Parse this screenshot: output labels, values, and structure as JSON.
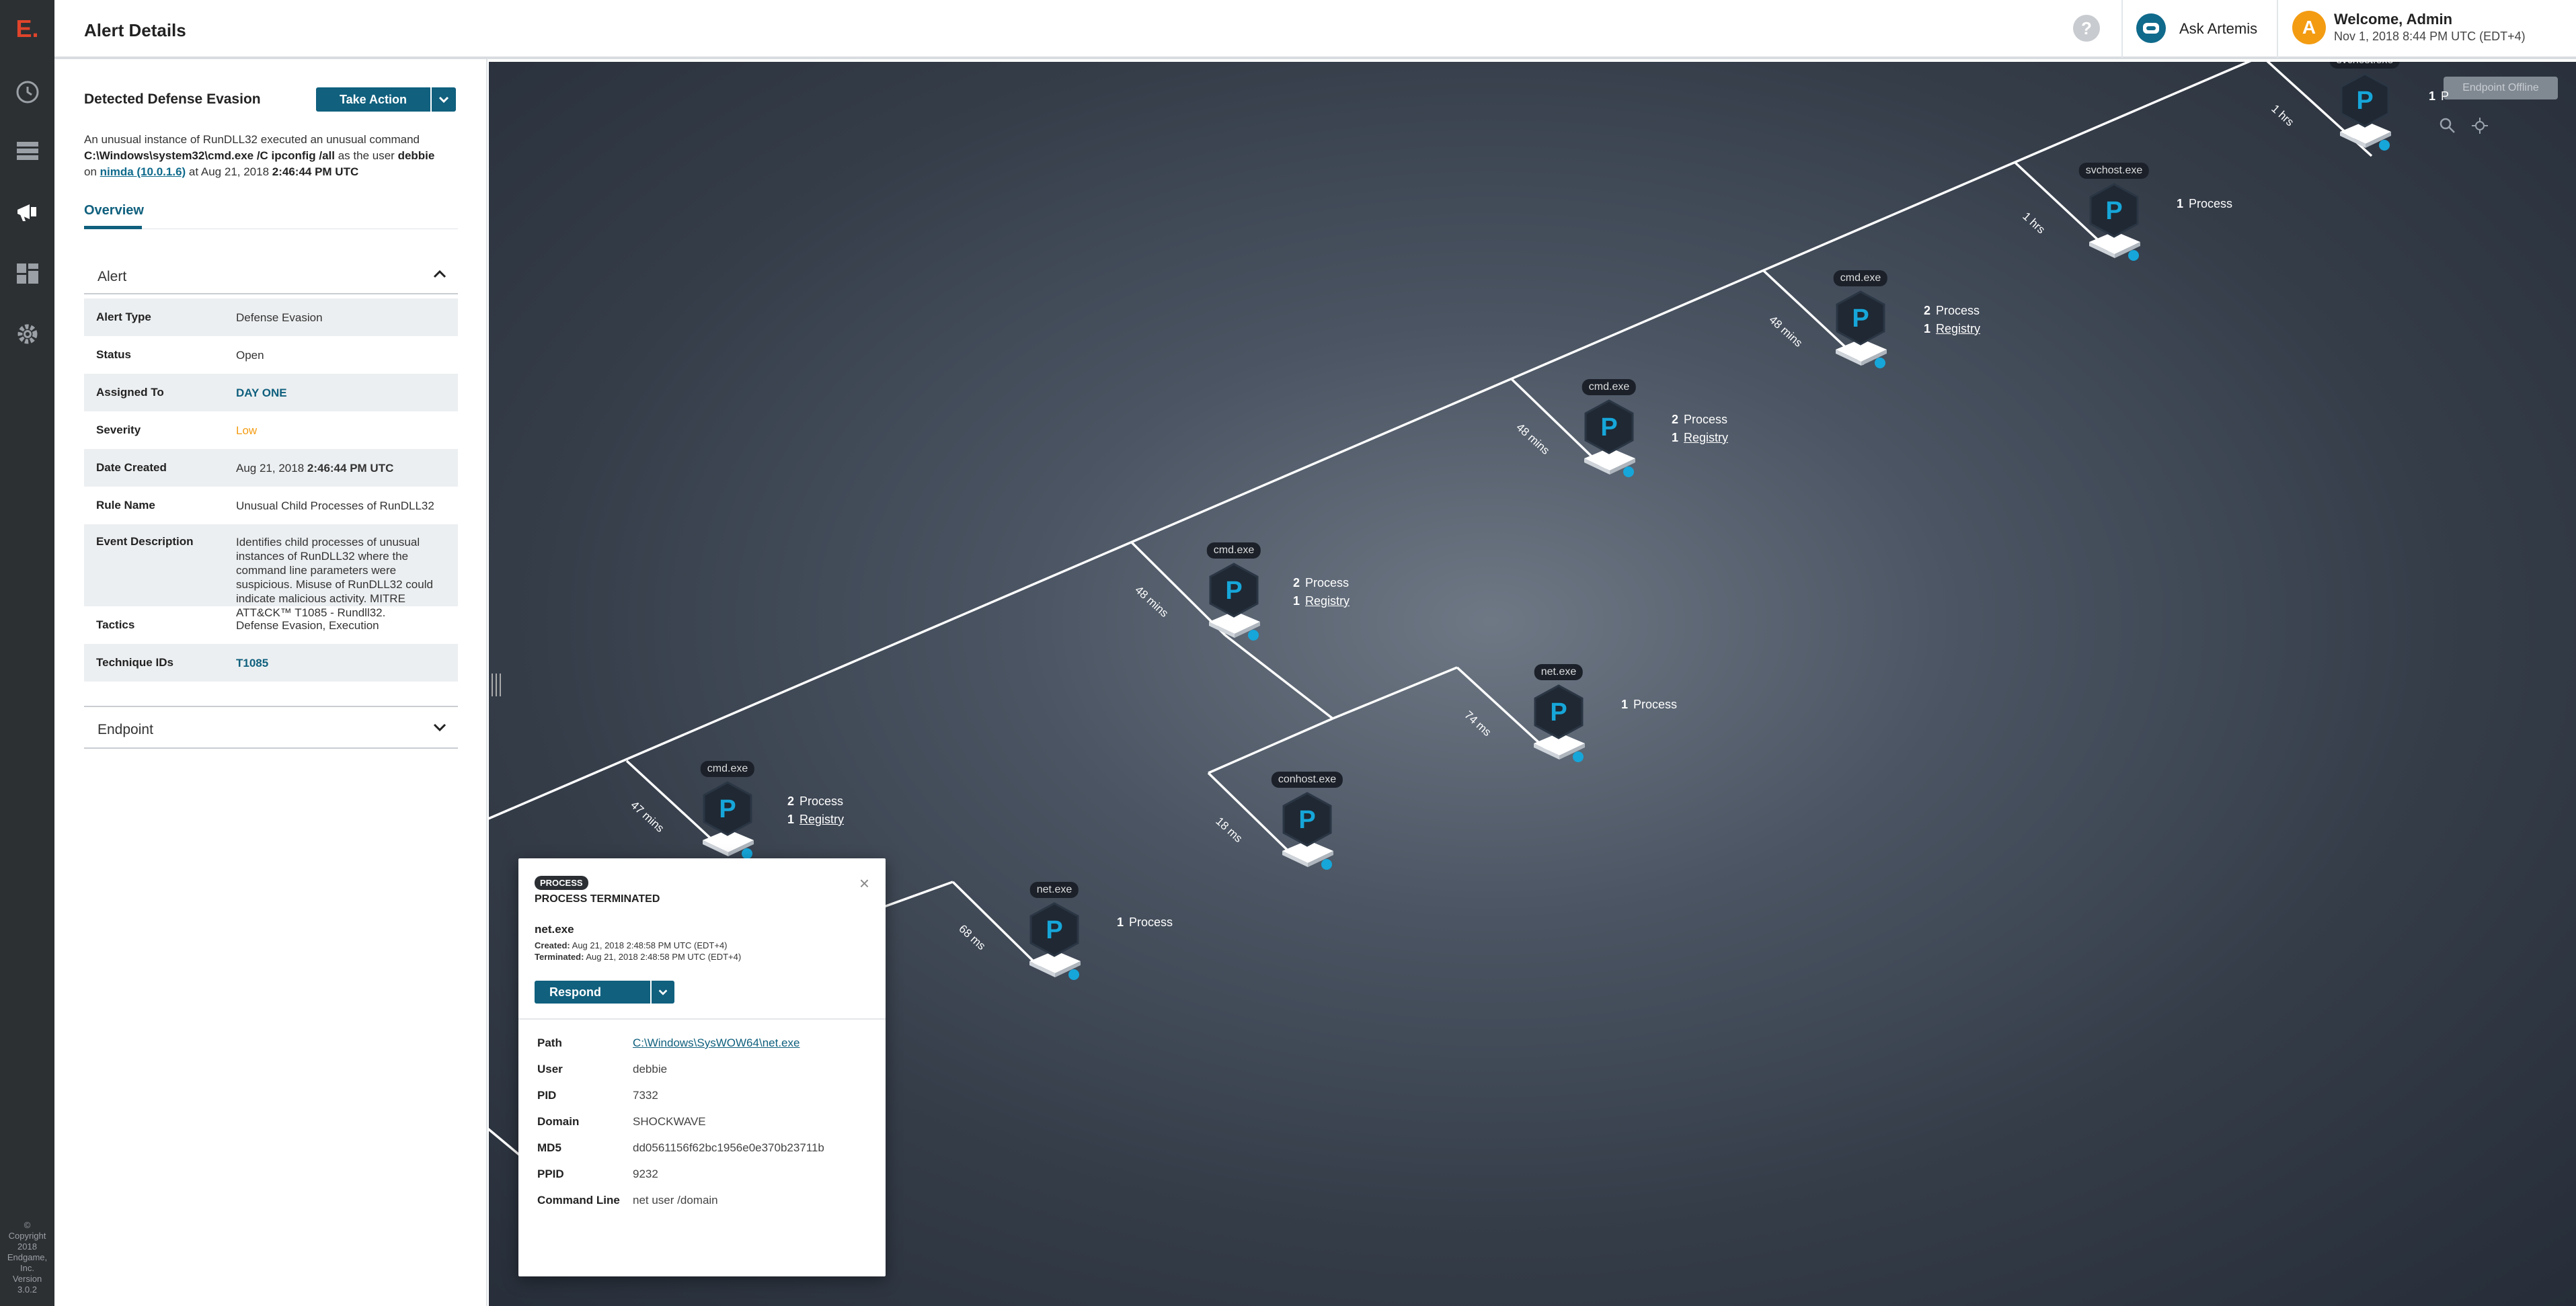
{
  "app": {
    "logo": "E.",
    "copyright": [
      "©",
      "Copyright",
      "2018",
      "Endgame,",
      "Inc.",
      "Version",
      "3.0.2"
    ]
  },
  "header": {
    "title": "Alert Details",
    "help": "?",
    "assistant": "Ask Artemis",
    "avatar_initial": "A",
    "welcome": "Welcome, Admin",
    "datetime": "Nov 1, 2018 8:44 PM UTC (EDT+4)"
  },
  "alert": {
    "title": "Detected Defense Evasion",
    "take_action": "Take Action",
    "desc_1": "An unusual instance of RunDLL32 executed an unusual command",
    "desc_cmd": "C:\\Windows\\system32\\cmd.exe /C ipconfig /all",
    "desc_as_user": " as the user ",
    "desc_user": "debbie",
    "desc_on": "on ",
    "desc_host": "nimda (10.0.1.6)",
    "desc_at": " at Aug 21, 2018 ",
    "desc_time": "2:46:44 PM UTC",
    "tab_overview": "Overview",
    "section_alert": "Alert",
    "section_endpoint": "Endpoint",
    "fields": [
      {
        "label": "Alert Type",
        "value": "Defense Evasion"
      },
      {
        "label": "Status",
        "value": "Open"
      },
      {
        "label": "Assigned To",
        "value": "DAY ONE"
      },
      {
        "label": "Severity",
        "value": "Low"
      },
      {
        "label": "Date Created",
        "value": "Aug 21, 2018 ",
        "value_bold": "2:46:44 PM UTC"
      },
      {
        "label": "Rule Name",
        "value": "Unusual Child Processes of RunDLL32"
      },
      {
        "label": "Event Description",
        "value": "Identifies child processes of unusual instances of RunDLL32 where the command line parameters were suspicious. Misuse of RunDLL32 could indicate malicious activity. MITRE ATT&CK™ T1085 - Rundll32."
      },
      {
        "label": "Tactics",
        "value": "Defense Evasion, Execution"
      },
      {
        "label": "Technique IDs",
        "value": "T1085"
      }
    ]
  },
  "graph": {
    "endpoint_offline": "Endpoint Offline",
    "nodes": [
      {
        "name": "svchost.exe",
        "icon": "P",
        "stats": [
          {
            "count": "1",
            "label": "P"
          }
        ]
      },
      {
        "name": "svchost.exe",
        "icon": "P",
        "stats": [
          {
            "count": "1",
            "label": "Process"
          }
        ]
      },
      {
        "name": "cmd.exe",
        "icon": "P",
        "stats": [
          {
            "count": "2",
            "label": "Process"
          },
          {
            "count": "1",
            "label": "Registry"
          }
        ]
      },
      {
        "name": "cmd.exe",
        "icon": "P",
        "stats": [
          {
            "count": "2",
            "label": "Process"
          },
          {
            "count": "1",
            "label": "Registry"
          }
        ]
      },
      {
        "name": "cmd.exe",
        "icon": "P",
        "stats": [
          {
            "count": "2",
            "label": "Process"
          },
          {
            "count": "1",
            "label": "Registry"
          }
        ]
      },
      {
        "name": "net.exe",
        "icon": "P",
        "stats": [
          {
            "count": "1",
            "label": "Process"
          }
        ]
      },
      {
        "name": "conhost.exe",
        "icon": "P",
        "stats": []
      },
      {
        "name": "cmd.exe",
        "icon": "P",
        "stats": [
          {
            "count": "2",
            "label": "Process"
          },
          {
            "count": "1",
            "label": "Registry"
          }
        ]
      },
      {
        "name": "net.exe",
        "icon": "P",
        "stats": [
          {
            "count": "1",
            "label": "Process"
          }
        ]
      }
    ],
    "edges": [
      "1 hrs",
      "1 hrs",
      "48 mins",
      "48 mins",
      "48 mins",
      "74 ms",
      "18 ms",
      "47 mins",
      "68 ms"
    ]
  },
  "popup": {
    "badge": "PROCESS",
    "status": "PROCESS TERMINATED",
    "name": "net.exe",
    "created_label": "Created:",
    "created": " Aug 21, 2018 2:48:58 PM UTC (EDT+4)",
    "terminated_label": "Terminated:",
    "terminated": " Aug 21, 2018 2:48:58 PM UTC (EDT+4)",
    "respond": "Respond",
    "close": "×",
    "details": [
      {
        "label": "Path",
        "value": "C:\\Windows\\SysWOW64\\net.exe"
      },
      {
        "label": "User",
        "value": "debbie"
      },
      {
        "label": "PID",
        "value": "7332"
      },
      {
        "label": "Domain",
        "value": "SHOCKWAVE"
      },
      {
        "label": "MD5",
        "value": "dd0561156f62bc1956e0e370b23711b"
      },
      {
        "label": "PPID",
        "value": "9232"
      },
      {
        "label": "Command Line",
        "value": "net user /domain"
      }
    ]
  }
}
